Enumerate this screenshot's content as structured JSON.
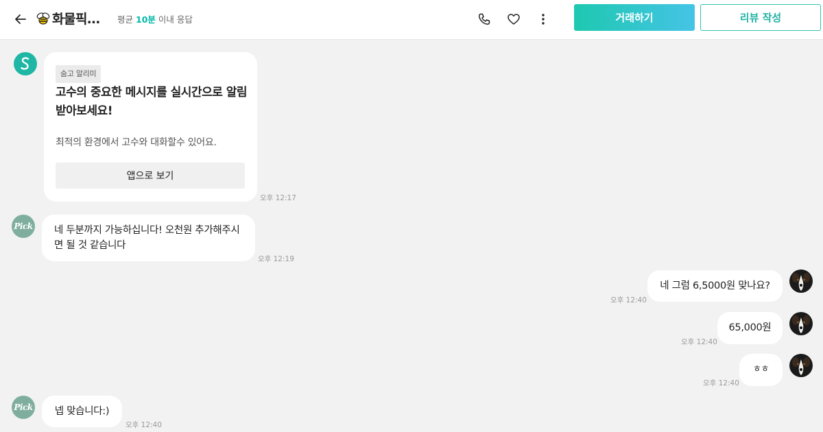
{
  "header": {
    "title": "화물픽…",
    "response_prefix": "평균",
    "response_time": "10분",
    "response_suffix": "이내 응답",
    "deal_button": "거래하기",
    "review_button": "리뷰 작성"
  },
  "colors": {
    "accent": "#1ec8b0",
    "accent_end": "#45c4e6",
    "background": "#f2f2f2"
  },
  "messages": {
    "card": {
      "tag": "숨고 알리미",
      "title": "고수의 중요한 메시지를 실시간으로 알림 받아보세요!",
      "desc": "최적의 환경에서 고수와 대화할수 있어요.",
      "button": "앱으로 보기",
      "time": "오후 12:17"
    },
    "m1": {
      "text": "네 두분까지 가능하십니다! 오천원 추가해주시면 될 것  같습니다",
      "time": "오후 12:19"
    },
    "m2": {
      "text": "네 그럼 6,5000원 맞나요?",
      "time": "오후 12:40"
    },
    "m3": {
      "text": "65,000원",
      "time": "오후 12:40"
    },
    "m4": {
      "text": "ㅎㅎ",
      "time": "오후 12:40"
    },
    "m5": {
      "text": "넵 맞습니다:)",
      "time": "오후 12:40"
    }
  },
  "avatars": {
    "pick_label": "Pick"
  }
}
